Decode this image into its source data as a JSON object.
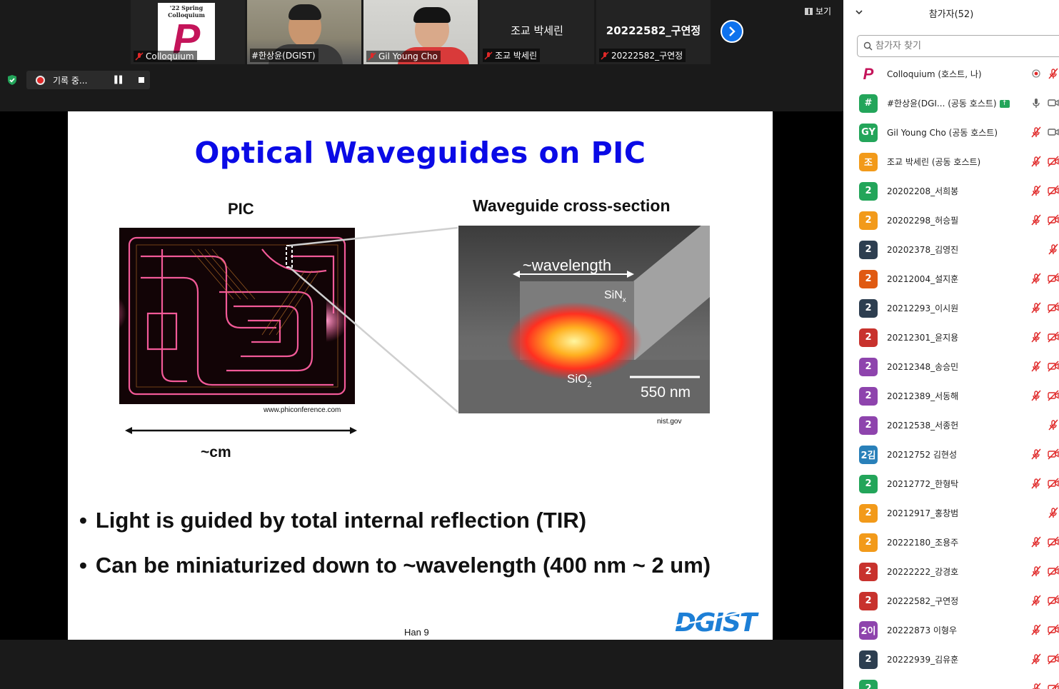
{
  "top": {
    "view_label": "보기",
    "recording_label": "기록 중...",
    "thumbnails": [
      {
        "name": "Colloquium",
        "logo_top": "'22 Spring Colloquium",
        "logo_letter": "P",
        "type": "logo"
      },
      {
        "name": "#한상윤(DGIST)",
        "type": "video1",
        "active": true
      },
      {
        "name": "Gil Young Cho",
        "type": "video2"
      },
      {
        "name": "조교 박세린",
        "center": "조교 박세린",
        "type": "name"
      },
      {
        "name": "20222582_구연정",
        "center": "20222582_구연정",
        "type": "name"
      }
    ]
  },
  "slide": {
    "title": "Optical Waveguides on PIC",
    "pic_label": "PIC",
    "xsec_label": "Waveguide cross-section",
    "pic_source": "www.phiconference.com",
    "xsec_source": "nist.gov",
    "scale_label": "~cm",
    "wavelength_label": "~wavelength",
    "sinx_label": "SiN",
    "sinx_sub": "x",
    "sio2_label": "SiO",
    "sio2_sub": "2",
    "scale_bar_label": "550 nm",
    "bullets": [
      "Light is guided by total internal reflection (TIR)",
      "Can be miniaturized down to ~wavelength (400 nm ~ 2 um)"
    ],
    "footer": "Han 9",
    "logo": "DGIST"
  },
  "panel": {
    "title": "참가자(52)",
    "search_placeholder": "참가자 찾기",
    "participants": [
      {
        "avatar": "P",
        "color": "#ffffff",
        "name": "Colloquium",
        "role": " (호스트, 나)",
        "icons": [
          "rec",
          "micoff"
        ],
        "logo": true
      },
      {
        "avatar": "#",
        "color": "#23a55a",
        "name": "#한상윤(DGI...",
        "role": " (공동 호스트)",
        "icons": [
          "mic",
          "cam"
        ],
        "share": true
      },
      {
        "avatar": "GY",
        "color": "#23a55a",
        "name": "Gil Young Cho",
        "role": " (공동 호스트)",
        "icons": [
          "micoff",
          "cam"
        ]
      },
      {
        "avatar": "조",
        "color": "#f29a1a",
        "name": "조교 박세린",
        "role": " (공동 호스트)",
        "icons": [
          "micoff",
          "camoff"
        ]
      },
      {
        "avatar": "2",
        "color": "#23a55a",
        "name": "20202208_서희봉",
        "role": "",
        "icons": [
          "micoff",
          "camoff"
        ]
      },
      {
        "avatar": "2",
        "color": "#f29a1a",
        "name": "20202298_허승필",
        "role": "",
        "icons": [
          "micoff",
          "camoff"
        ]
      },
      {
        "avatar": "2",
        "color": "#2d3e50",
        "name": "20202378_김영진",
        "role": "",
        "icons": [
          "micoff"
        ]
      },
      {
        "avatar": "2",
        "color": "#e05a12",
        "name": "20212004_설지훈",
        "role": "",
        "icons": [
          "micoff",
          "camoff"
        ]
      },
      {
        "avatar": "2",
        "color": "#2d3e50",
        "name": "20212293_이시원",
        "role": "",
        "icons": [
          "micoff",
          "camoff"
        ]
      },
      {
        "avatar": "2",
        "color": "#c8322d",
        "name": "20212301_윤지용",
        "role": "",
        "icons": [
          "micoff",
          "camoff"
        ]
      },
      {
        "avatar": "2",
        "color": "#8e44ad",
        "name": "20212348_송승민",
        "role": "",
        "icons": [
          "micoff",
          "camoff"
        ]
      },
      {
        "avatar": "2",
        "color": "#8e44ad",
        "name": "20212389_서동해",
        "role": "",
        "icons": [
          "micoff",
          "camoff"
        ]
      },
      {
        "avatar": "2",
        "color": "#8e44ad",
        "name": "20212538_서종헌",
        "role": "",
        "icons": [
          "micoff"
        ]
      },
      {
        "avatar": "2김",
        "color": "#2980b9",
        "name": "20212752 김현성",
        "role": "",
        "icons": [
          "micoff",
          "camoff"
        ]
      },
      {
        "avatar": "2",
        "color": "#23a55a",
        "name": "20212772_한형탁",
        "role": "",
        "icons": [
          "micoff",
          "camoff"
        ]
      },
      {
        "avatar": "2",
        "color": "#f29a1a",
        "name": "20212917_홍창범",
        "role": "",
        "icons": [
          "micoff"
        ]
      },
      {
        "avatar": "2",
        "color": "#f29a1a",
        "name": "20222180_조용주",
        "role": "",
        "icons": [
          "micoff",
          "camoff"
        ]
      },
      {
        "avatar": "2",
        "color": "#c8322d",
        "name": "20222222_강경호",
        "role": "",
        "icons": [
          "micoff",
          "camoff"
        ]
      },
      {
        "avatar": "2",
        "color": "#c8322d",
        "name": "20222582_구연정",
        "role": "",
        "icons": [
          "micoff",
          "camoff"
        ]
      },
      {
        "avatar": "2이",
        "color": "#8e44ad",
        "name": "20222873 이형우",
        "role": "",
        "icons": [
          "micoff",
          "camoff"
        ]
      },
      {
        "avatar": "2",
        "color": "#2d3e50",
        "name": "20222939_김유훈",
        "role": "",
        "icons": [
          "micoff",
          "camoff"
        ]
      },
      {
        "avatar": "2",
        "color": "#23a55a",
        "name": "",
        "role": "",
        "icons": [
          "micoff",
          "camoff"
        ]
      }
    ]
  }
}
